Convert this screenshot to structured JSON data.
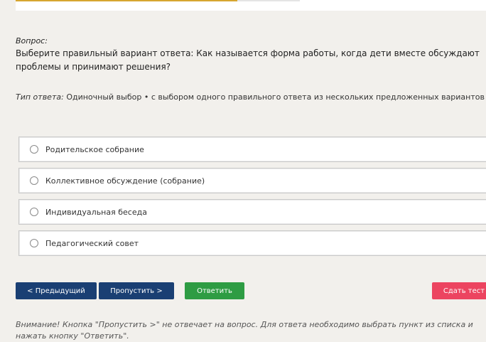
{
  "progress": {
    "fraction": 0.78
  },
  "question": {
    "label": "Вопрос:",
    "text": "Выберите правильный вариант ответа: Как называется форма работы, когда дети вместе обсуждают проблемы и принимают решения?"
  },
  "answer_type": {
    "label": "Тип ответа:",
    "value": "Одиночный выбор • с выбором одного правильного ответа из нескольких предложенных вариантов"
  },
  "options": [
    {
      "label": "Родительское собрание",
      "selected": false
    },
    {
      "label": "Коллективное обсуждение (собрание)",
      "selected": false
    },
    {
      "label": "Индивидуальная беседа",
      "selected": false
    },
    {
      "label": "Педагогический совет",
      "selected": false
    }
  ],
  "buttons": {
    "prev": "< Предыдущий",
    "skip": "Пропустить >",
    "answer": "Ответить",
    "finish": "Сдать тест"
  },
  "notice": "Внимание! Кнопка \"Пропустить >\" не отвечает на вопрос. Для ответа необходимо выбрать пункт из списка и нажать кнопку \"Ответить\"."
}
